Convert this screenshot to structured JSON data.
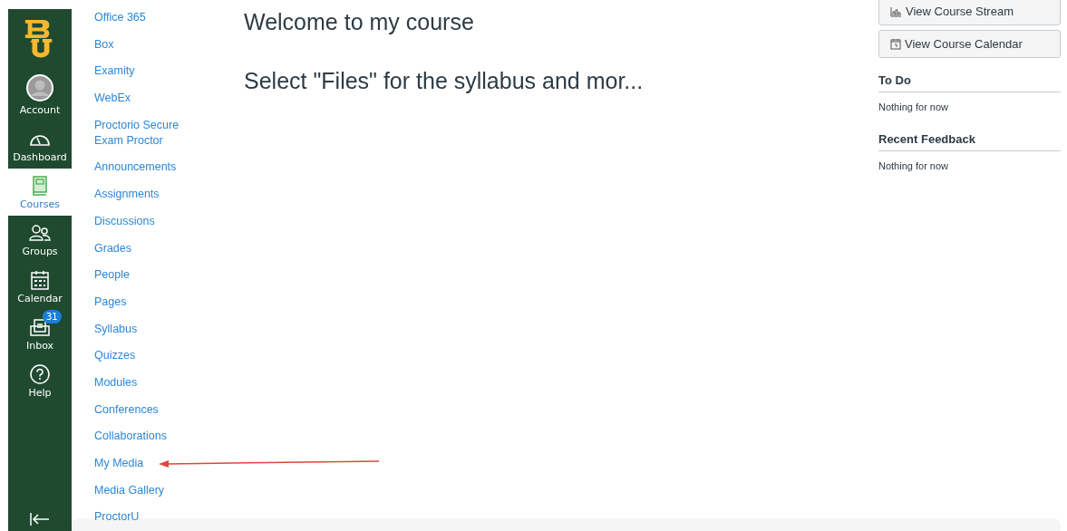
{
  "global_nav": [
    {
      "kind": "account",
      "label": "Account",
      "selected": false
    },
    {
      "kind": "dashboard",
      "label": "Dashboard",
      "selected": false
    },
    {
      "kind": "courses",
      "label": "Courses",
      "selected": true
    },
    {
      "kind": "groups",
      "label": "Groups",
      "selected": false
    },
    {
      "kind": "calendar",
      "label": "Calendar",
      "selected": false
    },
    {
      "kind": "inbox",
      "label": "Inbox",
      "selected": false,
      "badge": "31"
    },
    {
      "kind": "help",
      "label": "Help",
      "selected": false
    }
  ],
  "course_nav": [
    "Office 365",
    "Box",
    "Examity",
    "WebEx",
    "Proctorio Secure Exam Proctor",
    "Announcements",
    "Assignments",
    "Discussions",
    "Grades",
    "People",
    "Pages",
    "Syllabus",
    "Quizzes",
    "Modules",
    "Conferences",
    "Collaborations",
    "My Media",
    "Media Gallery",
    "ProctorU"
  ],
  "content": {
    "title": "Welcome to my course",
    "subtitle": "Select \"Files\" for the syllabus and mor..."
  },
  "sidebar": {
    "buttons": [
      {
        "kind": "stream",
        "label": "View Course Stream"
      },
      {
        "kind": "calendar",
        "label": "View Course Calendar"
      }
    ],
    "sections": [
      {
        "title": "To Do",
        "text": "Nothing for now"
      },
      {
        "title": "Recent Feedback",
        "text": "Nothing for now"
      }
    ]
  }
}
